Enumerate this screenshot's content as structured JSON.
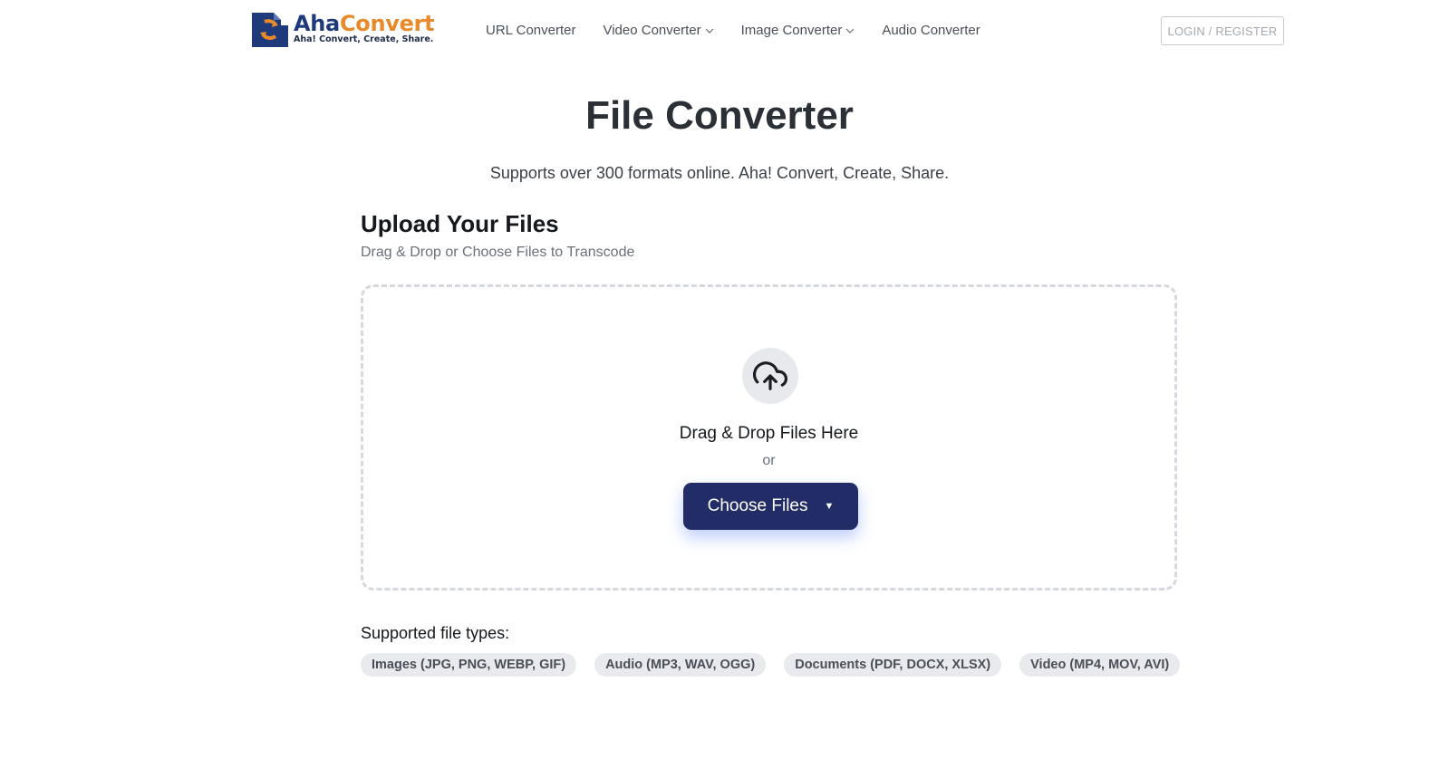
{
  "brand": {
    "name_part1": "Aha",
    "name_part2": "Convert",
    "tagline": "Aha! Convert, Create, Share.",
    "colors": {
      "primary": "#1e3a7b",
      "accent": "#e8892a"
    }
  },
  "nav": {
    "items": [
      {
        "label": "URL Converter",
        "dropdown": false
      },
      {
        "label": "Video Converter",
        "dropdown": true
      },
      {
        "label": "Image Converter",
        "dropdown": true
      },
      {
        "label": "Audio Converter",
        "dropdown": false
      }
    ],
    "login_label": "LOGIN / REGISTER"
  },
  "hero": {
    "title": "File Converter",
    "subtitle": "Supports over 300 formats online. Aha! Convert, Create, Share."
  },
  "upload": {
    "heading": "Upload Your Files",
    "subheading": "Drag & Drop or Choose Files to Transcode",
    "dropzone": {
      "icon": "cloud-upload-icon",
      "text": "Drag & Drop Files Here",
      "or": "or",
      "button_label": "Choose Files",
      "button_color": "#222c66"
    }
  },
  "supported": {
    "heading": "Supported file types:",
    "types": [
      "Images (JPG, PNG, WEBP, GIF)",
      "Audio (MP3, WAV, OGG)",
      "Documents (PDF, DOCX, XLSX)",
      "Video (MP4, MOV, AVI)"
    ]
  }
}
